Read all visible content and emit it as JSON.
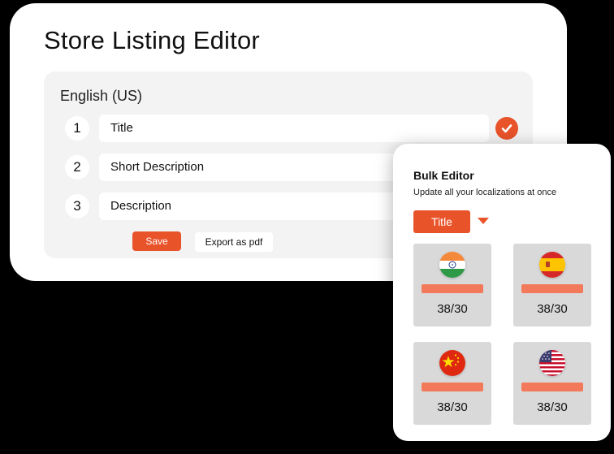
{
  "editor": {
    "title": "Store Listing Editor",
    "language": "English (US)",
    "fields": [
      {
        "number": "1",
        "label": "Title"
      },
      {
        "number": "2",
        "label": "Short Description"
      },
      {
        "number": "3",
        "label": "Description"
      }
    ],
    "save_label": "Save",
    "export_label": "Export as pdf"
  },
  "bulk_editor": {
    "title": "Bulk Editor",
    "subtitle": "Update all your localizations at once",
    "dropdown_value": "Title",
    "locales": [
      {
        "flag": "india-flag-icon",
        "count": "38/30"
      },
      {
        "flag": "spain-flag-icon",
        "count": "38/30"
      },
      {
        "flag": "china-flag-icon",
        "count": "38/30"
      },
      {
        "flag": "usa-flag-icon",
        "count": "38/30"
      }
    ]
  },
  "colors": {
    "accent": "#e8532a",
    "bar": "#f27a5a",
    "tile": "#d9d9d9",
    "panel": "#f3f3f3"
  }
}
